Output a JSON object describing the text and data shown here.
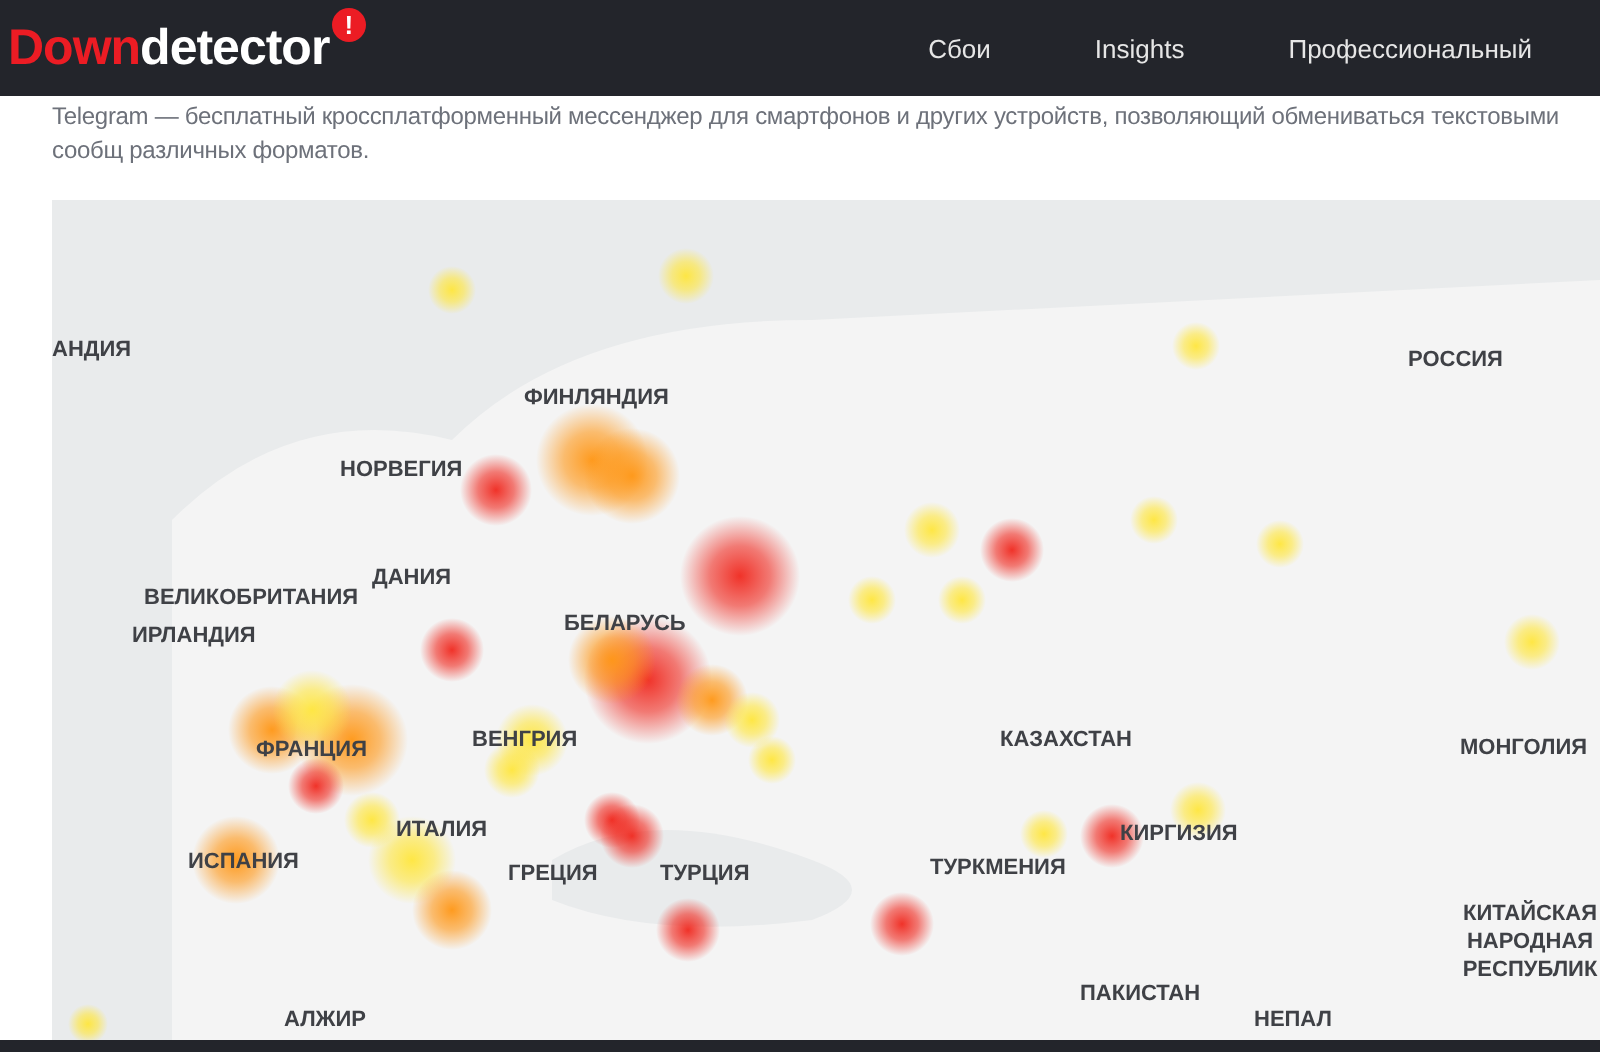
{
  "header": {
    "logo": {
      "part_1": "Down",
      "part_2": "detector",
      "badge": "!"
    },
    "nav": [
      {
        "label": "Сбои"
      },
      {
        "label": "Insights"
      },
      {
        "label": "Профессиональный"
      }
    ]
  },
  "description": "Telegram — бесплатный кроссплатформенный мессенджер для смартфонов и других устройств, позволяющий обмениваться текстовыми сообщ различных форматов.",
  "map": {
    "labels": [
      "АНДИЯ",
      "ФИНЛЯНДИЯ",
      "НОРВЕГИЯ",
      "ДАНИЯ",
      "ВЕЛИКОБРИТАНИЯ",
      "ИРЛАНДИЯ",
      "БЕЛАРУСЬ",
      "ФРАНЦИЯ",
      "ВЕНГРИЯ",
      "ИТАЛИЯ",
      "ИСПАНИЯ",
      "ГРЕЦИЯ",
      "ТУРЦИЯ",
      "АЛЖИР",
      "РОССИЯ",
      "КАЗАХСТАН",
      "МОНГОЛИЯ",
      "КИРГИЗИЯ",
      "ТУРКМЕНИЯ",
      "КИТАЙСКАЯ НАРОДНАЯ РЕСПУБЛИК",
      "ПАКИСТАН",
      "НЕПАЛ"
    ]
  }
}
